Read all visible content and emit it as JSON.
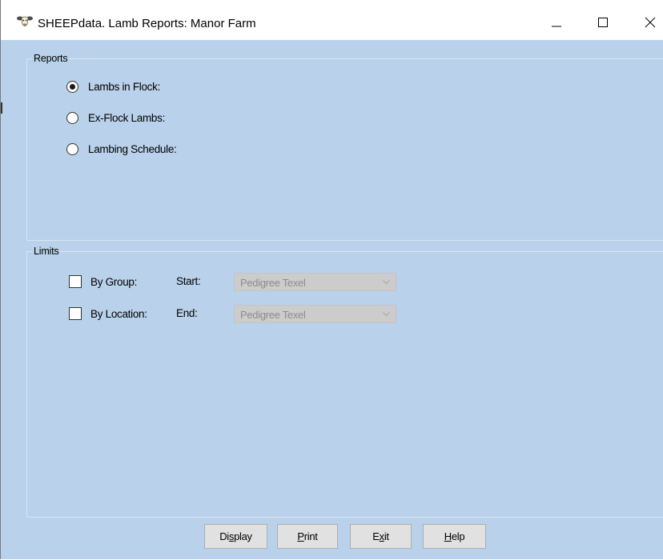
{
  "window": {
    "title": "SHEEPdata. Lamb Reports: Manor Farm",
    "icon": "sheep-head-icon",
    "controls": [
      "minimize-icon",
      "maximize-icon",
      "close-icon"
    ]
  },
  "reports": {
    "legend": "Reports",
    "options": [
      {
        "label": "Lambs in Flock:",
        "checked": true
      },
      {
        "label": "Ex-Flock Lambs:",
        "checked": false
      },
      {
        "label": "Lambing Schedule:",
        "checked": false
      }
    ]
  },
  "limits": {
    "legend": "Limits",
    "by_group": {
      "label": "By Group:",
      "checked": false
    },
    "by_location": {
      "label": "By Location:",
      "checked": false
    },
    "start_label": "Start:",
    "end_label": "End:",
    "start_value": "Pedigree Texel",
    "end_value": "Pedigree Texel"
  },
  "buttons": {
    "display": {
      "pre": "Di",
      "mnemonic": "s",
      "post": "play"
    },
    "print": {
      "pre": "",
      "mnemonic": "P",
      "post": "rint"
    },
    "exit": {
      "pre": "E",
      "mnemonic": "x",
      "post": "it"
    },
    "help": {
      "pre": "",
      "mnemonic": "H",
      "post": "elp"
    }
  },
  "colors": {
    "client_background": "#b9d1ea",
    "titlebar_background": "#ffffff",
    "disabled_combo": "#cccccc",
    "disabled_text": "#8c8c8c"
  }
}
